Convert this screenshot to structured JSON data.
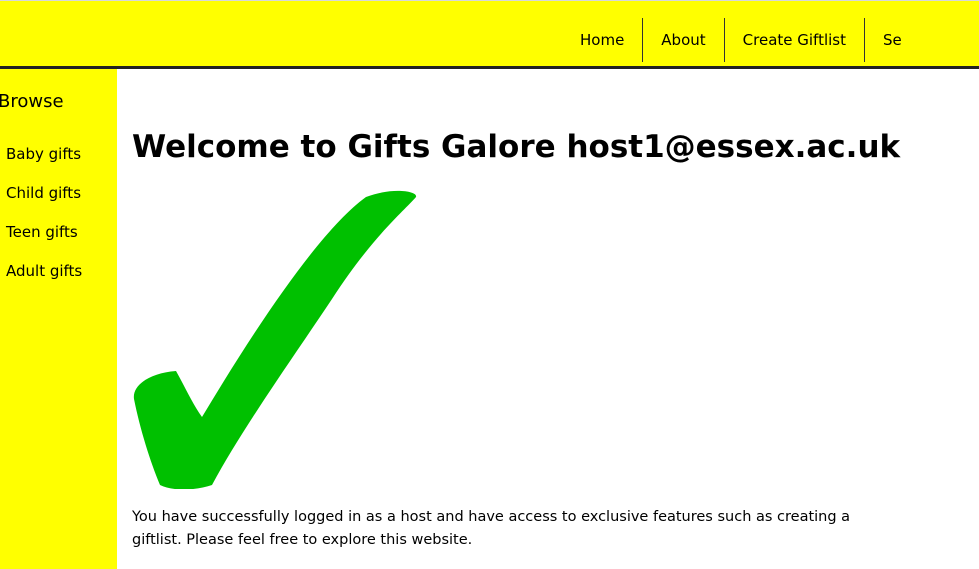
{
  "nav": {
    "items": [
      {
        "label": "Home"
      },
      {
        "label": "About"
      },
      {
        "label": "Create Giftlist"
      },
      {
        "label": "Se"
      }
    ]
  },
  "sidebar": {
    "title": "Browse",
    "items": [
      {
        "label": "Baby gifts"
      },
      {
        "label": "Child gifts"
      },
      {
        "label": "Teen gifts"
      },
      {
        "label": "Adult gifts"
      }
    ]
  },
  "main": {
    "title": "Welcome to Gifts Galore host1@essex.ac.uk",
    "intro": "You have successfully logged in as a host and have access to exclusive features such as creating a giftlist. Please feel free to explore this website."
  },
  "colors": {
    "header_bg": "#ffff00",
    "sidebar_bg": "#ffff00",
    "checkmark": "#00c000"
  },
  "icons": {
    "checkmark": "checkmark-icon"
  }
}
